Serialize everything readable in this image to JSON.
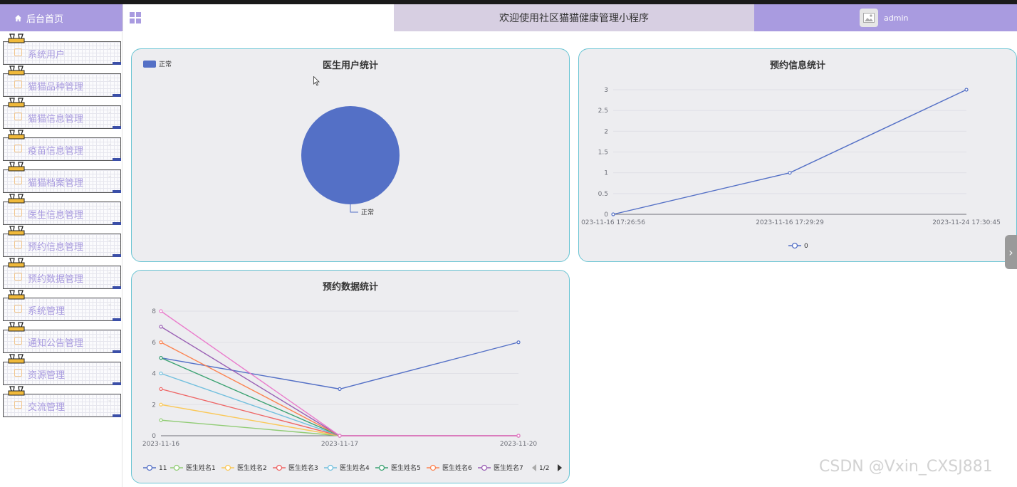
{
  "header": {
    "home_label": "后台首页",
    "title": "欢迎使用社区猫猫健康管理小程序",
    "username": "admin"
  },
  "sidebar": {
    "items": [
      {
        "label": "系统用户"
      },
      {
        "label": "猫猫品种管理"
      },
      {
        "label": "猫猫信息管理"
      },
      {
        "label": "疫苗信息管理"
      },
      {
        "label": "猫猫档案管理"
      },
      {
        "label": "医生信息管理"
      },
      {
        "label": "预约信息管理"
      },
      {
        "label": "预约数据管理"
      },
      {
        "label": "系统管理"
      },
      {
        "label": "通知公告管理"
      },
      {
        "label": "资源管理"
      },
      {
        "label": "交流管理"
      }
    ]
  },
  "colors": {
    "accent": "#a99be0",
    "card_border": "#69c4d3",
    "card_bg": "#ededf0",
    "series": [
      "#5470c6",
      "#91cc75",
      "#fac858",
      "#ee6666",
      "#73c0de",
      "#3ba272",
      "#fc8452",
      "#9a60b4",
      "#ea7ccc"
    ]
  },
  "watermark": "CSDN @Vxin_CXSJ881",
  "chart_data": [
    {
      "type": "pie",
      "title": "医生用户统计",
      "legend": [
        "正常"
      ],
      "legend_position": "top-left",
      "slices": [
        {
          "name": "正常",
          "value": 1
        }
      ]
    },
    {
      "type": "line",
      "title": "预约信息统计",
      "x": [
        "2023-11-16 17:26:56",
        "2023-11-16 17:29:29",
        "2023-11-24 17:30:45"
      ],
      "x_tick_labels": [
        "023-11-16 17:26:56",
        "2023-11-16 17:29:29",
        "2023-11-24 17:30:45"
      ],
      "series": [
        {
          "name": "0",
          "values": [
            0,
            1,
            3
          ]
        }
      ],
      "ylim": [
        0,
        3
      ],
      "yticks": [
        "0",
        "0.5",
        "1",
        "1.5",
        "2",
        "2.5",
        "3"
      ],
      "grid": true,
      "legend_position": "bottom"
    },
    {
      "type": "line",
      "title": "预约数据统计",
      "x": [
        "2023-11-16",
        "2023-11-17",
        "2023-11-20"
      ],
      "series": [
        {
          "name": "11",
          "values": [
            5,
            3,
            6
          ]
        },
        {
          "name": "医生姓名1",
          "values": [
            1,
            0,
            0
          ]
        },
        {
          "name": "医生姓名2",
          "values": [
            2,
            0,
            0
          ]
        },
        {
          "name": "医生姓名3",
          "values": [
            3,
            0,
            0
          ]
        },
        {
          "name": "医生姓名4",
          "values": [
            4,
            0,
            0
          ]
        },
        {
          "name": "医生姓名5",
          "values": [
            5,
            0,
            0
          ]
        },
        {
          "name": "医生姓名6",
          "values": [
            6,
            0,
            0
          ]
        },
        {
          "name": "医生姓名7",
          "values": [
            7,
            0,
            0
          ]
        },
        {
          "name": "",
          "values": [
            8,
            0,
            0
          ]
        }
      ],
      "ylim": [
        0,
        8
      ],
      "yticks": [
        "0",
        "2",
        "4",
        "6",
        "8"
      ],
      "grid": true,
      "legend_position": "bottom",
      "legend_page": "1/2"
    }
  ]
}
